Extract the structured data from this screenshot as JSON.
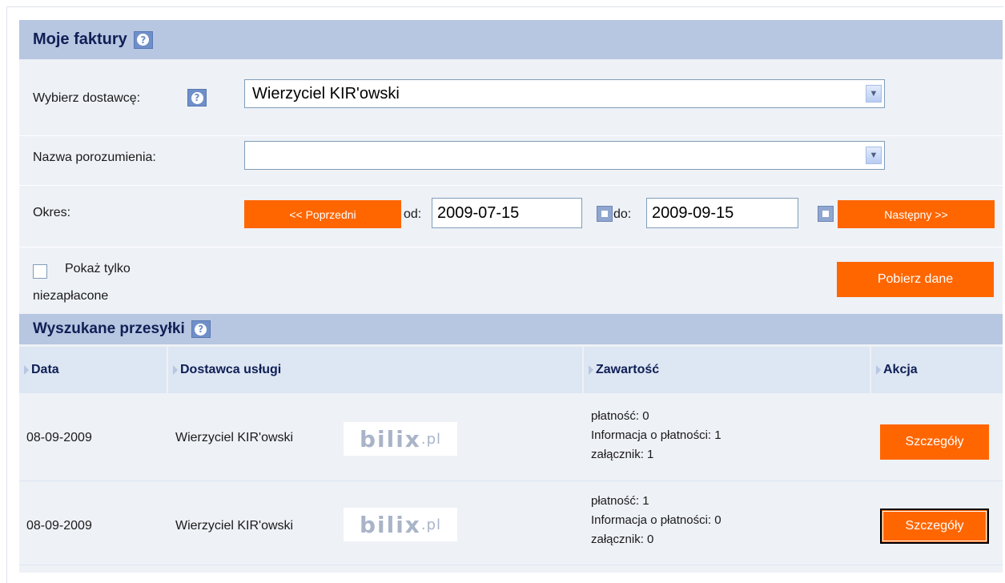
{
  "header": {
    "title": "Moje faktury"
  },
  "supplier": {
    "label": "Wybierz dostawcę:",
    "value": "Wierzyciel KIR'owski"
  },
  "agreement": {
    "label": "Nazwa porozumienia:",
    "value": ""
  },
  "period": {
    "label": "Okres:",
    "prev_label": "<< Poprzedni",
    "from_label": "od:",
    "from_value": "2009-07-15",
    "to_label": "do:",
    "to_value": "2009-09-15",
    "next_label": "Następny >>"
  },
  "filter": {
    "unpaid_line1": "Pokaż tylko",
    "unpaid_line2": "niezapłacone",
    "fetch_label": "Pobierz dane"
  },
  "results": {
    "title": "Wyszukane przesyłki",
    "columns": [
      "Data",
      "Dostawca usługi",
      "Zawartość",
      "Akcja"
    ],
    "rows": [
      {
        "date": "08-09-2009",
        "supplier": "Wierzyciel KIR'owski",
        "logo": "bilix.pl",
        "payment": "płatność: 0",
        "info": "Informacja o płatności: 1",
        "attachment": "załącznik: 1",
        "action": "Szczegóły"
      },
      {
        "date": "08-09-2009",
        "supplier": "Wierzyciel KIR'owski",
        "logo": "bilix.pl",
        "payment": "płatność: 1",
        "info": "Informacja o płatności: 0",
        "attachment": "załącznik: 0",
        "action": "Szczegóły"
      }
    ]
  },
  "colors": {
    "accent": "#ff6600",
    "header_bg": "#b7c6e1",
    "panel_bg": "#eef1f6",
    "help_icon": "#6f8fc9"
  },
  "icons": [
    "help-icon",
    "dropdown-arrow-icon",
    "calendar-icon",
    "column-marker-icon"
  ]
}
